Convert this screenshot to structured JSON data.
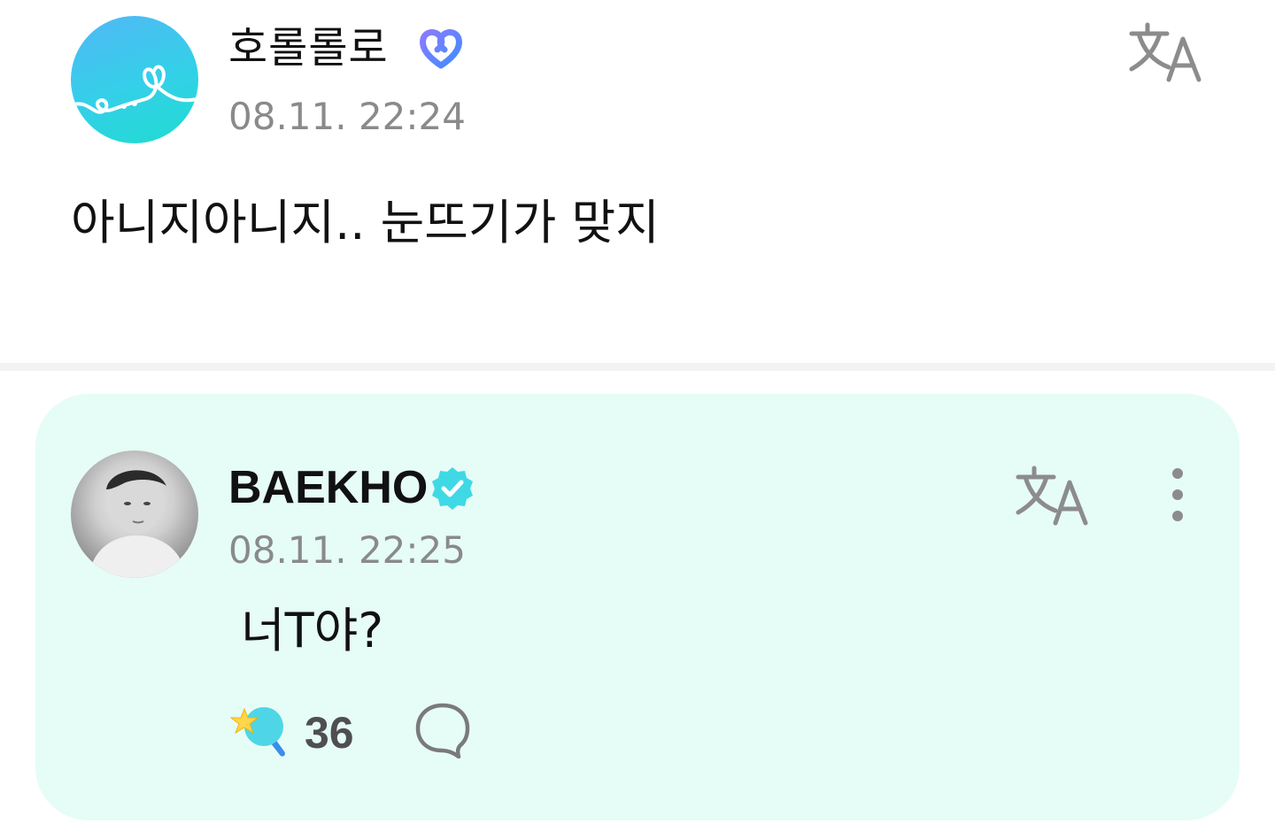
{
  "post": {
    "author": "호롤롤로",
    "time": "08.11. 22:24",
    "text": "아니지아니지.. 눈뜨기가 맞지",
    "badge_icon": "heart-link-badge-icon",
    "translate_icon": "translate-icon"
  },
  "reply": {
    "author": "BAEKHO",
    "time": "08.11. 22:25",
    "text": "너T야?",
    "badge_icon": "verified-badge-icon",
    "reaction_count": "36",
    "reaction_icon": "star-lightstick-icon",
    "comment_icon": "comment-bubble-icon"
  },
  "colors": {
    "reply_background": "#e6fcf7",
    "verified": "#3fd9e6",
    "time_text": "#8a8a8a",
    "divider": "#f3f3f3"
  }
}
